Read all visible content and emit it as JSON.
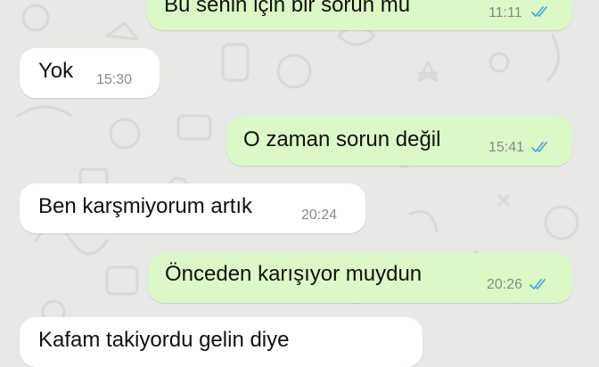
{
  "chat": {
    "colors": {
      "incoming_bubble": "#ffffff",
      "outgoing_bubble": "#dcf8c6",
      "wallpaper": "#e8e8e6",
      "read_tick": "#4fa9e6"
    },
    "messages": [
      {
        "direction": "out",
        "text": "Bu senin için bir sorun mu",
        "time": "11:11",
        "status": "read"
      },
      {
        "direction": "in",
        "text": "Yok",
        "time": "15:30"
      },
      {
        "direction": "out",
        "text": "O zaman sorun değil",
        "time": "15:41",
        "status": "read"
      },
      {
        "direction": "in",
        "text": "Ben karşmiyorum artık",
        "time": "20:24"
      },
      {
        "direction": "out",
        "text": "Önceden karışıyor muydun",
        "time": "20:26",
        "status": "read"
      },
      {
        "direction": "in",
        "text": "Kafam takiyordu gelin diye",
        "time": ""
      }
    ]
  }
}
